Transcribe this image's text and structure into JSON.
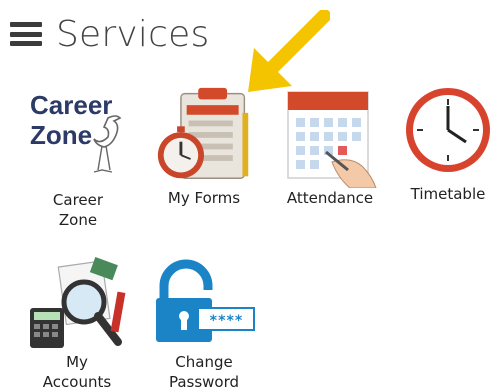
{
  "header": {
    "title": "Services"
  },
  "services": [
    {
      "id": "career-zone",
      "label": "Career\nZone",
      "logo_line1": "Career",
      "logo_line2": "Zone"
    },
    {
      "id": "my-forms",
      "label": "My Forms"
    },
    {
      "id": "attendance",
      "label": "Attendance"
    },
    {
      "id": "timetable",
      "label": "Timetable"
    },
    {
      "id": "my-accounts",
      "label": "My\nAccounts"
    },
    {
      "id": "change-password",
      "label": "Change\nPassword",
      "password_mask": "****"
    }
  ],
  "colors": {
    "arrow": "#f5c400",
    "career_text": "#2b3a67",
    "lock": "#1a84c7"
  }
}
